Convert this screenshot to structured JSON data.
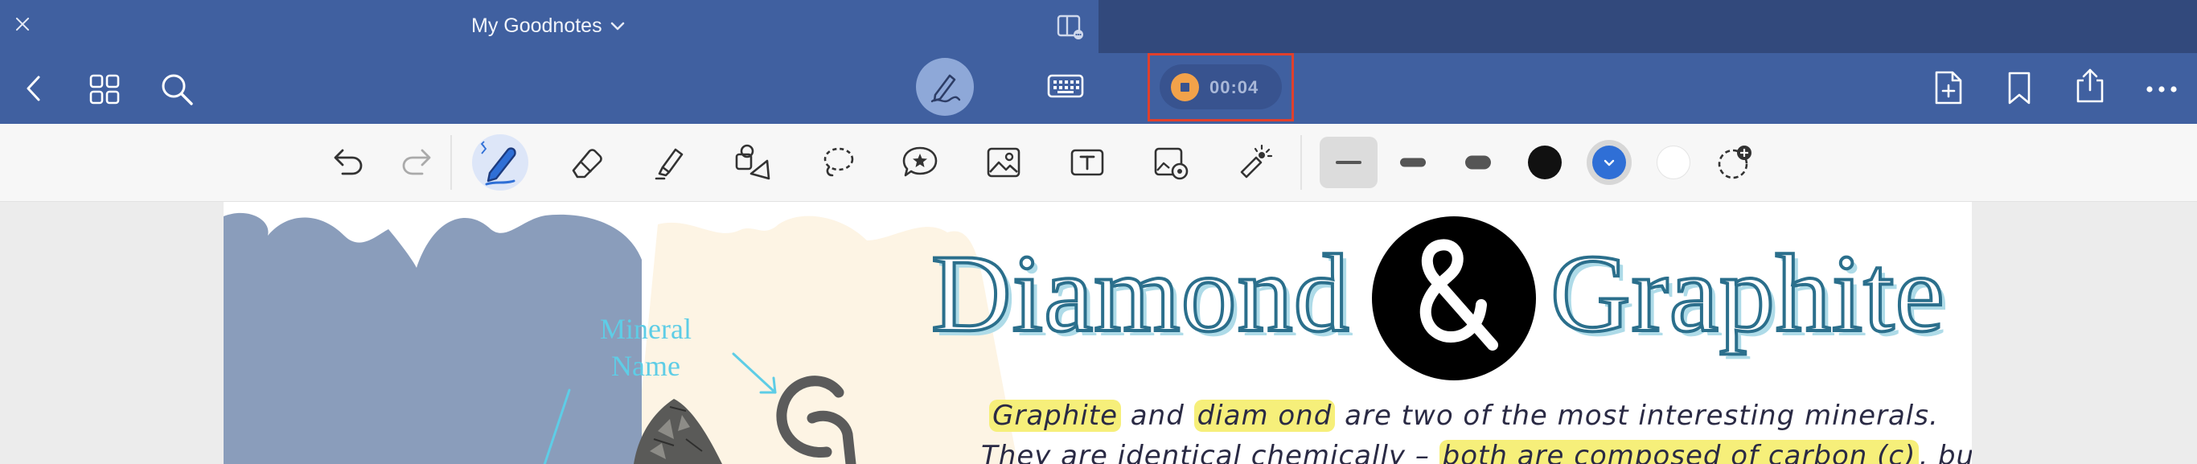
{
  "window": {
    "title": "My Goodnotes"
  },
  "recording": {
    "time": "00:04"
  },
  "page": {
    "mineral_label_line1": "Mineral",
    "mineral_label_line2": "Name",
    "title_word_1": "Diamond",
    "title_word_2": "Graphite",
    "note_line_1": {
      "hl_1": "Graphite",
      "t_1": " and ",
      "hl_2": "diam ond",
      "t_2": " are two of the most interesting minerals."
    },
    "note_line_2": {
      "t_1": "They are identical chemically – ",
      "hl_1": "both are composed of carbon (c)",
      "t_2": ", but"
    }
  },
  "colors": {
    "toolbar_bg": "#4060a0",
    "titlebar_bg": "#32497c",
    "record_accent": "#f2a24a",
    "record_highlight_border": "#e0402c",
    "active_pen_color": "#2f6fd6",
    "swatch_black": "#111111",
    "swatch_blue": "#2f6fd6",
    "swatch_white": "#ffffff",
    "title_stroke": "#2b6f8c",
    "mineral_label": "#5ecde6",
    "note_highlight": "#f6ef7a"
  },
  "tools": {
    "selected_tool": "pen",
    "selected_stroke": "thin",
    "selected_color": "blue",
    "tool_icons": [
      "undo-icon",
      "redo-icon",
      "pen-icon",
      "eraser-icon",
      "highlighter-icon",
      "shapes-icon",
      "lasso-icon",
      "sticker-icon",
      "image-icon",
      "text-box-icon",
      "camera-icon",
      "laser-pointer-icon"
    ],
    "stroke_options": [
      "thin",
      "medium",
      "thick"
    ]
  }
}
